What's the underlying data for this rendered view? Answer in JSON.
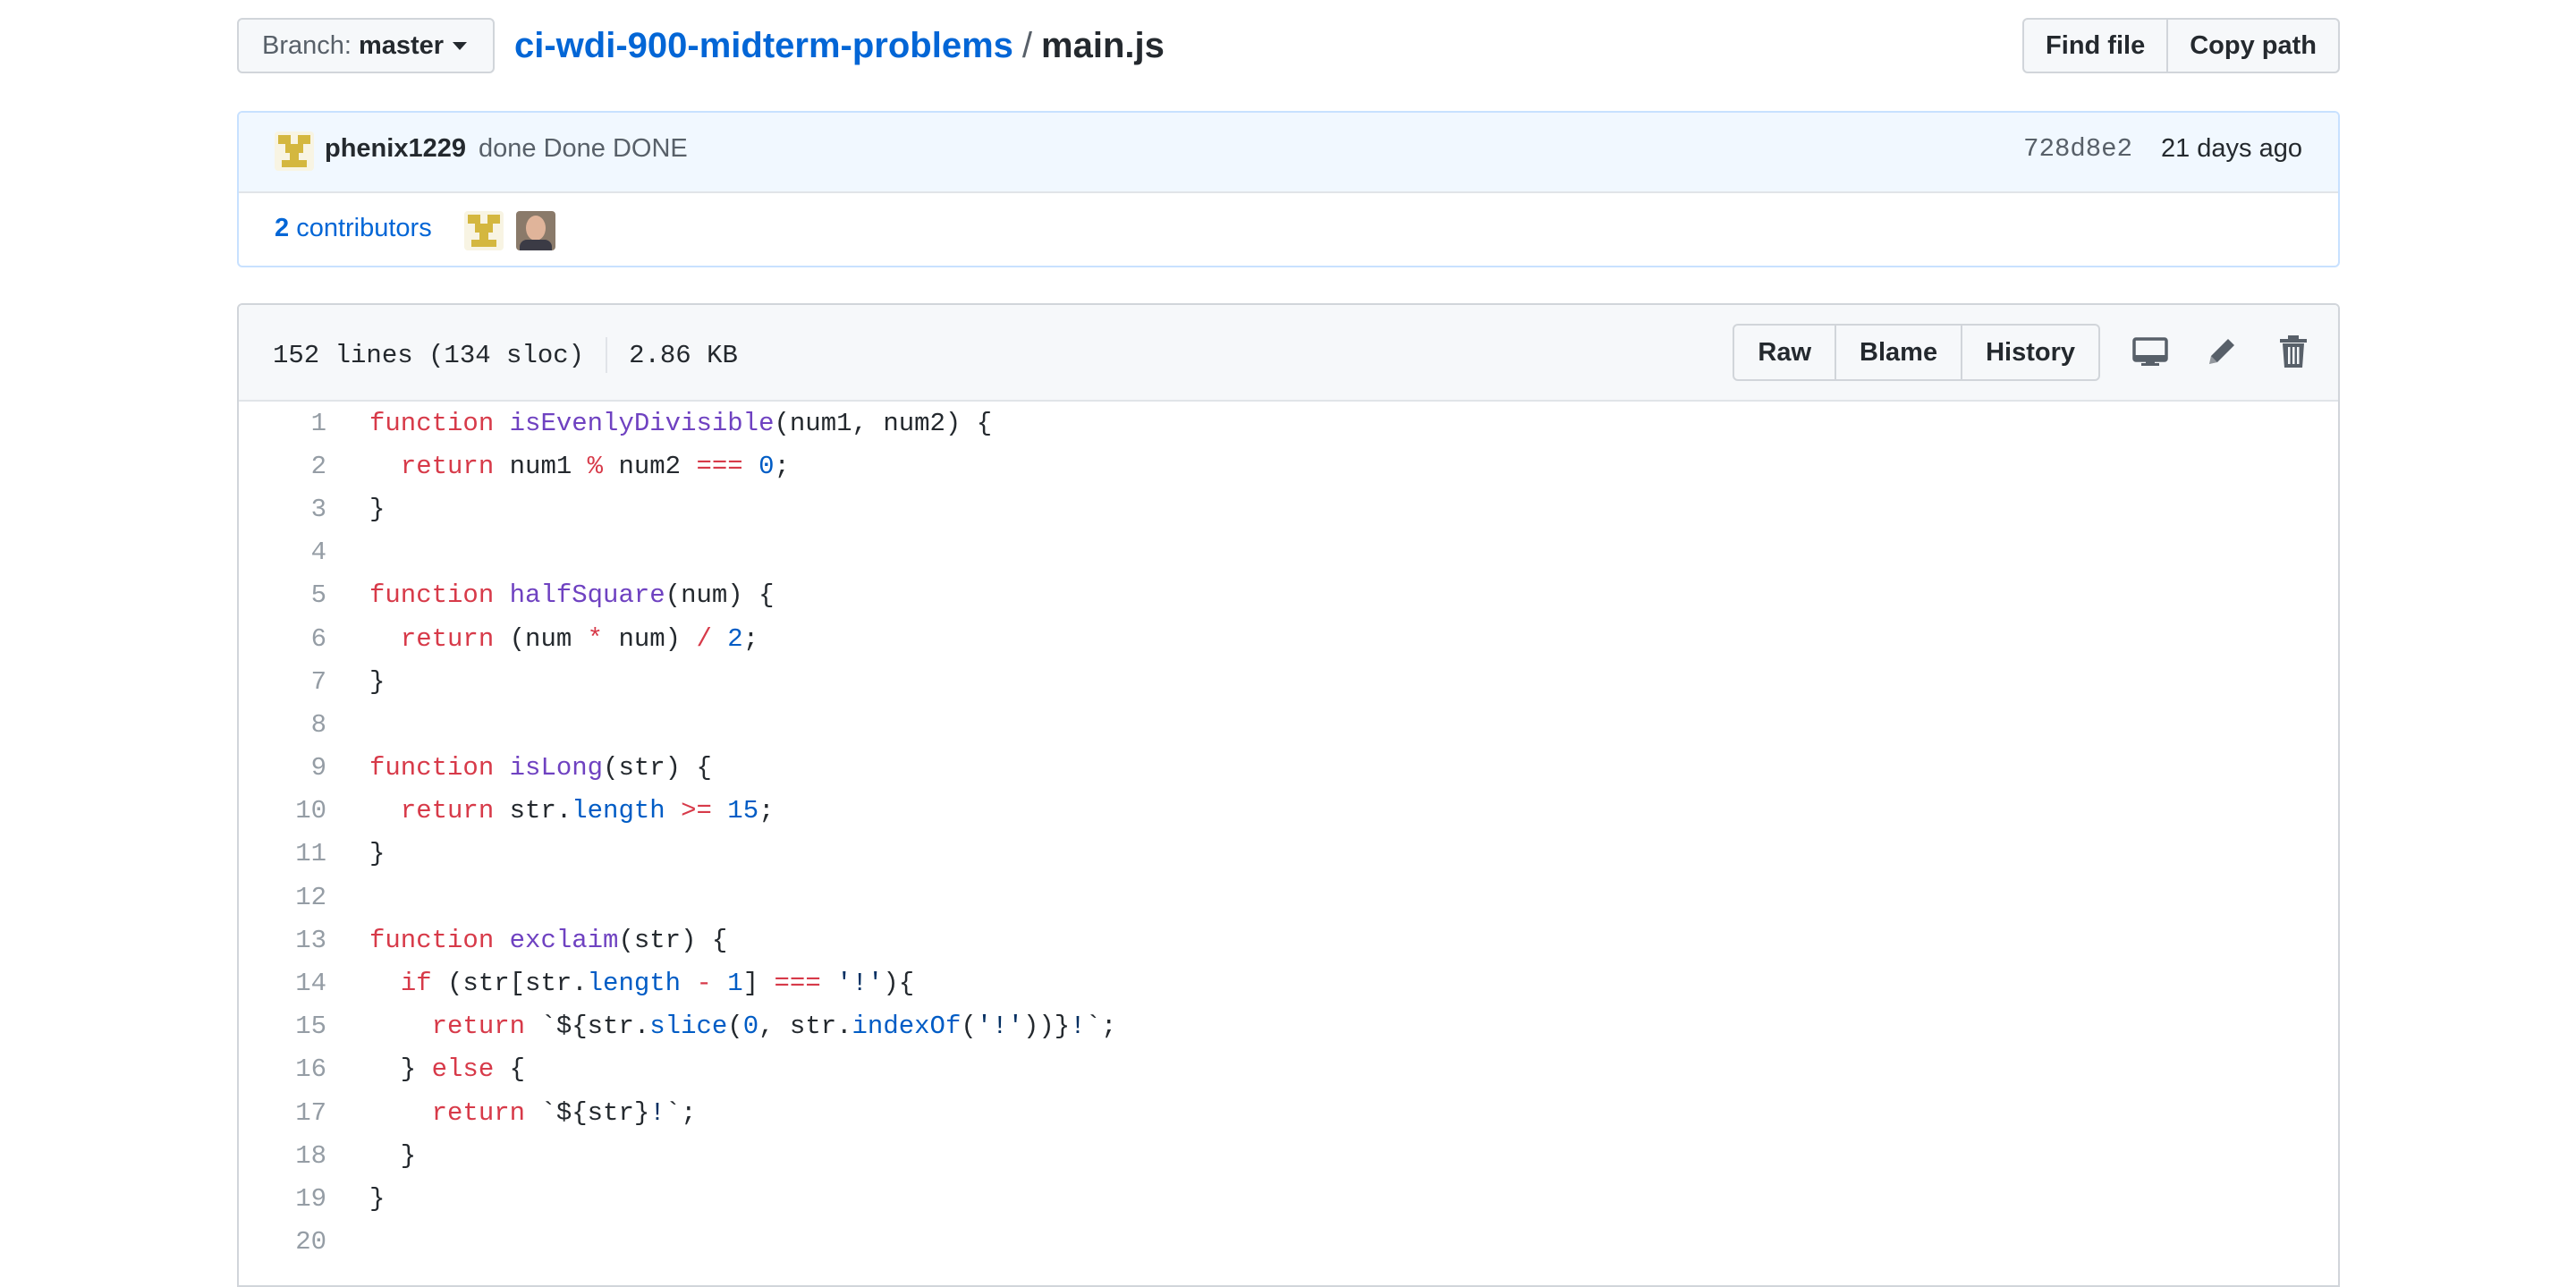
{
  "branch": {
    "label": "Branch:",
    "value": "master"
  },
  "breadcrumb": {
    "repo": "ci-wdi-900-midterm-problems",
    "separator": "/",
    "file": "main.js"
  },
  "file_nav": {
    "find_file": "Find file",
    "copy_path": "Copy path"
  },
  "commit": {
    "author": "phenix1229",
    "message": "done Done DONE",
    "sha": "728d8e2",
    "time": "21 days ago",
    "contributors_count": "2",
    "contributors_label": "contributors"
  },
  "file": {
    "lines_info": "152 lines (134 sloc)",
    "size": "2.86 KB",
    "actions": {
      "raw": "Raw",
      "blame": "Blame",
      "history": "History"
    },
    "icons": [
      "desktop-icon",
      "pencil-icon",
      "trash-icon"
    ]
  },
  "code": [
    {
      "n": "1",
      "text": "function isEvenlyDivisible(num1, num2) {"
    },
    {
      "n": "2",
      "text": "  return num1 % num2 === 0;"
    },
    {
      "n": "3",
      "text": "}"
    },
    {
      "n": "4",
      "text": ""
    },
    {
      "n": "5",
      "text": "function halfSquare(num) {"
    },
    {
      "n": "6",
      "text": "  return (num * num) / 2;"
    },
    {
      "n": "7",
      "text": "}"
    },
    {
      "n": "8",
      "text": ""
    },
    {
      "n": "9",
      "text": "function isLong(str) {"
    },
    {
      "n": "10",
      "text": "  return str.length >= 15;"
    },
    {
      "n": "11",
      "text": "}"
    },
    {
      "n": "12",
      "text": ""
    },
    {
      "n": "13",
      "text": "function exclaim(str) {"
    },
    {
      "n": "14",
      "text": "  if (str[str.length - 1] === '!'){"
    },
    {
      "n": "15",
      "text": "    return `${str.slice(0, str.indexOf('!'))}!`;"
    },
    {
      "n": "16",
      "text": "  } else {"
    },
    {
      "n": "17",
      "text": "    return `${str}!`;"
    },
    {
      "n": "18",
      "text": "  }"
    },
    {
      "n": "19",
      "text": "}"
    },
    {
      "n": "20",
      "text": ""
    }
  ],
  "colors": {
    "keyword": "#d73a49",
    "function": "#6f42c1",
    "constant": "#005cc5",
    "string": "#032f62",
    "link": "#0366d6"
  }
}
